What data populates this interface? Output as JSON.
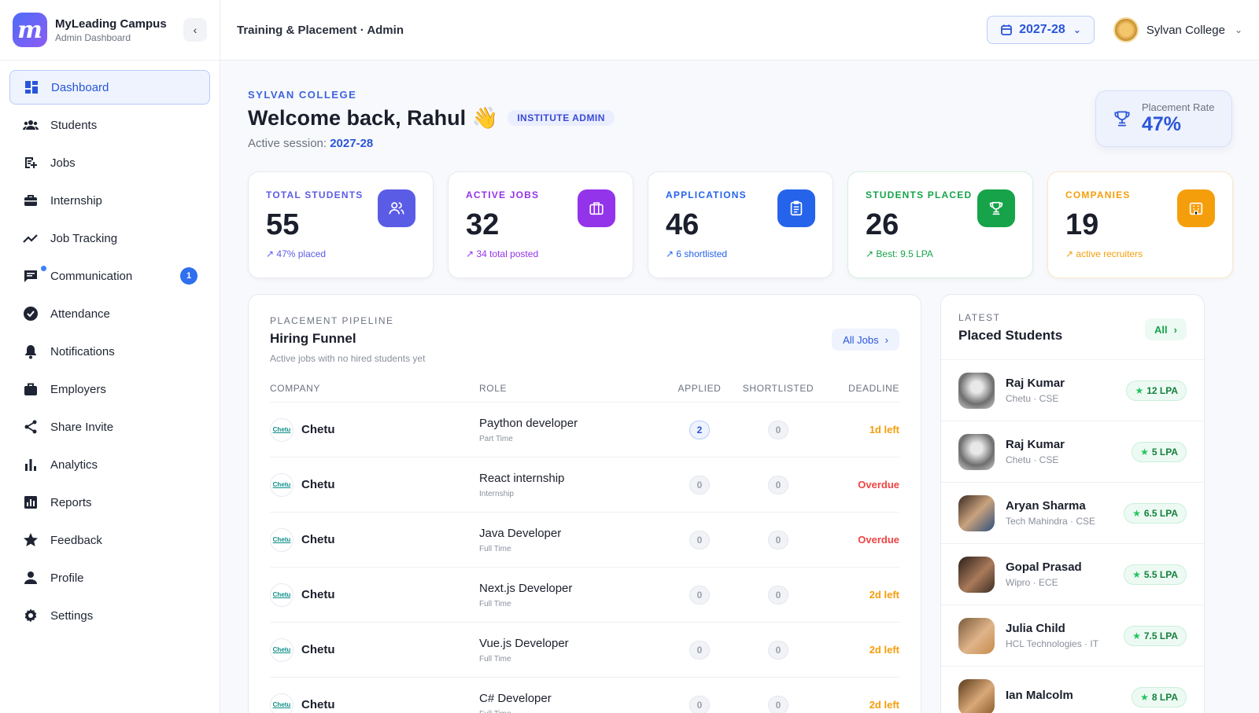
{
  "brand": {
    "title": "MyLeading Campus",
    "subtitle": "Admin Dashboard",
    "logo_letter": "m"
  },
  "sidebar": {
    "items": [
      {
        "label": "Dashboard",
        "icon": "dashboard-icon",
        "active": true
      },
      {
        "label": "Students",
        "icon": "students-icon"
      },
      {
        "label": "Jobs",
        "icon": "jobs-icon"
      },
      {
        "label": "Internship",
        "icon": "internship-icon"
      },
      {
        "label": "Job Tracking",
        "icon": "trending-icon"
      },
      {
        "label": "Communication",
        "icon": "chat-icon",
        "badge": "1"
      },
      {
        "label": "Attendance",
        "icon": "check-circle-icon"
      },
      {
        "label": "Notifications",
        "icon": "bell-icon"
      },
      {
        "label": "Employers",
        "icon": "briefcase-icon"
      },
      {
        "label": "Share Invite",
        "icon": "share-icon"
      },
      {
        "label": "Analytics",
        "icon": "bar-chart-icon"
      },
      {
        "label": "Reports",
        "icon": "report-icon"
      },
      {
        "label": "Feedback",
        "icon": "star-icon"
      },
      {
        "label": "Profile",
        "icon": "person-icon"
      },
      {
        "label": "Settings",
        "icon": "gear-icon"
      }
    ]
  },
  "topbar": {
    "title": "Training & Placement · Admin",
    "session": "2027-28",
    "college": "Sylvan College"
  },
  "welcome": {
    "org": "SYLVAN COLLEGE",
    "title": "Welcome back, Rahul 👋",
    "role": "INSTITUTE ADMIN",
    "session_label": "Active session:",
    "session_value": "2027-28"
  },
  "placement_rate": {
    "label": "Placement Rate",
    "value": "47%"
  },
  "stats": [
    {
      "label": "TOTAL STUDENTS",
      "value": "55",
      "note": "47% placed",
      "color": "#5b5ce6",
      "icon": "users-icon"
    },
    {
      "label": "ACTIVE JOBS",
      "value": "32",
      "note": "34 total posted",
      "color": "#9333ea",
      "icon": "briefcase-icon"
    },
    {
      "label": "APPLICATIONS",
      "value": "46",
      "note": "6 shortlisted",
      "color": "#2563eb",
      "icon": "clipboard-icon"
    },
    {
      "label": "STUDENTS PLACED",
      "value": "26",
      "note": "Best: 9.5 LPA",
      "color": "#16a34a",
      "icon": "trophy-icon"
    },
    {
      "label": "COMPANIES",
      "value": "19",
      "note": "active recruiters",
      "color": "#f59e0b",
      "icon": "building-icon"
    }
  ],
  "pipeline": {
    "eyebrow": "PLACEMENT PIPELINE",
    "title": "Hiring Funnel",
    "subtitle": "Active jobs with no hired students yet",
    "all_label": "All Jobs",
    "columns": [
      "COMPANY",
      "ROLE",
      "APPLIED",
      "SHORTLISTED",
      "DEADLINE"
    ],
    "rows": [
      {
        "company": "Chetu",
        "role": "Paython developer",
        "type": "Part Time",
        "applied": "2",
        "shortlisted": "0",
        "deadline": "1d left",
        "status": "warn"
      },
      {
        "company": "Chetu",
        "role": "React internship",
        "type": "Internship",
        "applied": "0",
        "shortlisted": "0",
        "deadline": "Overdue",
        "status": "bad"
      },
      {
        "company": "Chetu",
        "role": "Java Developer",
        "type": "Full Time",
        "applied": "0",
        "shortlisted": "0",
        "deadline": "Overdue",
        "status": "bad"
      },
      {
        "company": "Chetu",
        "role": "Next.js Developer",
        "type": "Full Time",
        "applied": "0",
        "shortlisted": "0",
        "deadline": "2d left",
        "status": "warn"
      },
      {
        "company": "Chetu",
        "role": "Vue.js Developer",
        "type": "Full Time",
        "applied": "0",
        "shortlisted": "0",
        "deadline": "2d left",
        "status": "warn"
      },
      {
        "company": "Chetu",
        "role": "C# Developer",
        "type": "Full Time",
        "applied": "0",
        "shortlisted": "0",
        "deadline": "2d left",
        "status": "warn"
      }
    ],
    "logo_text": "Chetu"
  },
  "placed": {
    "eyebrow": "LATEST",
    "title": "Placed Students",
    "all_label": "All",
    "rows": [
      {
        "name": "Raj Kumar",
        "meta": "Chetu · CSE",
        "lpa": "12 LPA"
      },
      {
        "name": "Raj Kumar",
        "meta": "Chetu · CSE",
        "lpa": "5 LPA"
      },
      {
        "name": "Aryan Sharma",
        "meta": "Tech Mahindra · CSE",
        "lpa": "6.5 LPA"
      },
      {
        "name": "Gopal Prasad",
        "meta": "Wipro · ECE",
        "lpa": "5.5 LPA"
      },
      {
        "name": "Julia Child",
        "meta": "HCL Technologies · IT",
        "lpa": "7.5 LPA"
      },
      {
        "name": "Ian Malcolm",
        "meta": "",
        "lpa": "8 LPA"
      }
    ]
  },
  "colors": {
    "accent": "#2a55d9",
    "warn": "#f59e0b",
    "bad": "#ef4444"
  }
}
